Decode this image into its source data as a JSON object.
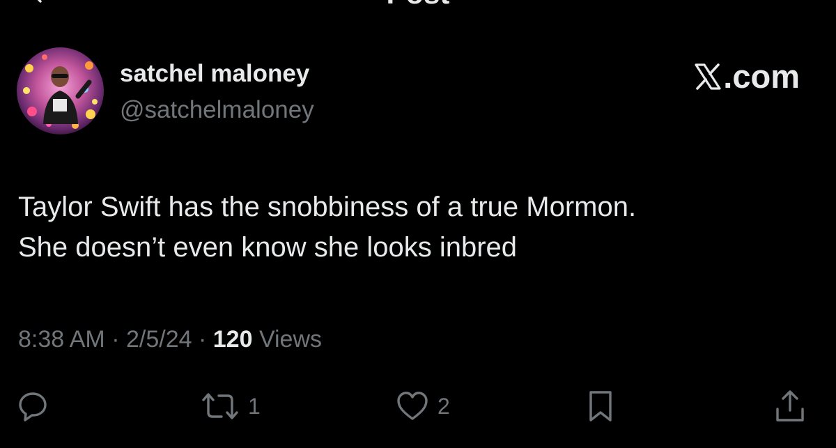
{
  "nav": {
    "title": "Post"
  },
  "author": {
    "display_name": "satchel maloney",
    "handle": "@satchelmaloney"
  },
  "watermark": {
    "text": ".com"
  },
  "tweet": {
    "lines": [
      "Taylor Swift has the snobbiness of a true Mormon.",
      "She doesn’t even know she looks inbred"
    ]
  },
  "meta": {
    "time": "8:38 AM",
    "separator": "·",
    "date": "2/5/24",
    "views_count": "120",
    "views_label": "Views"
  },
  "actions": {
    "reply_icon": "reply-icon",
    "repost_icon": "repost-icon",
    "repost_count": "1",
    "like_icon": "heart-icon",
    "like_count": "2",
    "bookmark_icon": "bookmark-icon",
    "share_icon": "share-icon"
  },
  "colors": {
    "background": "#000000",
    "primary_text": "#e7e9ea",
    "secondary_text": "#71767b"
  }
}
